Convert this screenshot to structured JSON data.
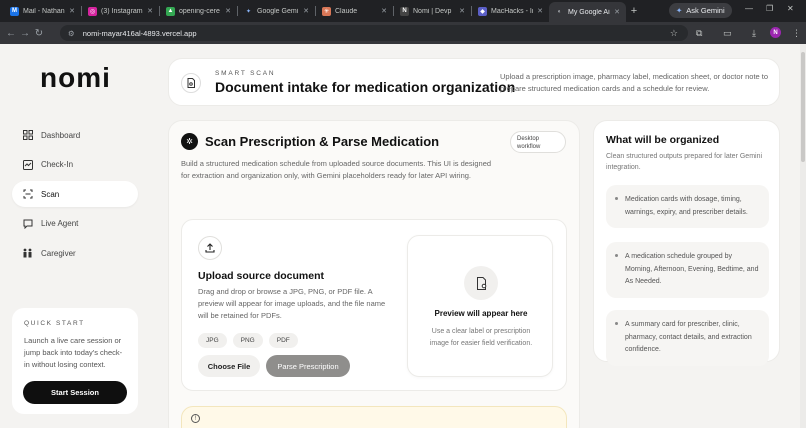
{
  "browser": {
    "tabs": [
      {
        "label": "Mail - Nathan",
        "icon_color": "#1a73e8",
        "icon": "mail-icon"
      },
      {
        "label": "(3) Instagram",
        "icon_color": "#d6249f",
        "icon": "instagram-icon"
      },
      {
        "label": "opening-cere",
        "icon_color": "#34a853",
        "icon": "drive-icon"
      },
      {
        "label": "Google Gemi",
        "icon_color": "#4285f4",
        "icon": "gemini-icon"
      },
      {
        "label": "Claude",
        "icon_color": "#d97757",
        "icon": "claude-icon"
      },
      {
        "label": "Nomi | Devp",
        "icon_color": "#111111",
        "icon": "nomi-icon"
      },
      {
        "label": "MacHacks - Ir",
        "icon_color": "#5b5fc7",
        "icon": "machacks-icon"
      },
      {
        "label": "My Google Ai",
        "icon_color": "#9aa0a6",
        "icon": "google-icon"
      }
    ],
    "ask_gemini": "Ask Gemini",
    "url": "nomi-mayar416al-4893.vercel.app",
    "avatar_letter": "N"
  },
  "sidebar": {
    "logo": "nomi",
    "items": [
      {
        "label": "Dashboard",
        "icon": "dashboard-icon"
      },
      {
        "label": "Check-In",
        "icon": "check-in-icon"
      },
      {
        "label": "Scan",
        "icon": "scan-icon"
      },
      {
        "label": "Live Agent",
        "icon": "live-agent-icon"
      },
      {
        "label": "Caregiver",
        "icon": "caregiver-icon"
      }
    ],
    "active": "Scan",
    "quick_start": {
      "eyebrow": "QUICK START",
      "text": "Launch a live care session or jump back into today's check-in without losing context.",
      "button": "Start Session"
    }
  },
  "header": {
    "eyebrow": "SMART SCAN",
    "title": "Document intake for medication organization",
    "description": "Upload a prescription image, pharmacy label, medication sheet, or doctor note to prepare structured medication cards and a schedule for review."
  },
  "scan": {
    "title": "Scan Prescription & Parse Medication",
    "badge": "Desktop workflow",
    "description": "Build a structured medication schedule from uploaded source documents. This UI is designed for extraction and organization only, with Gemini placeholders ready for later API wiring.",
    "upload": {
      "title": "Upload source document",
      "description": "Drag and drop or browse a JPG, PNG, or PDF file. A preview will appear for image uploads, and the file name will be retained for PDFs.",
      "chips": [
        "JPG",
        "PNG",
        "PDF"
      ],
      "choose_file": "Choose File",
      "parse": "Parse Prescription"
    },
    "preview": {
      "title": "Preview will appear here",
      "description": "Use a clear label or prescription image for easier field verification."
    }
  },
  "organized": {
    "title": "What will be organized",
    "subtitle": "Clean structured outputs prepared for later Gemini integration.",
    "items": [
      "Medication cards with dosage, timing, warnings, expiry, and prescriber details.",
      "A medication schedule grouped by Morning, Afternoon, Evening, Bedtime, and As Needed.",
      "A summary card for prescriber, clinic, pharmacy, contact details, and extraction confidence."
    ]
  }
}
